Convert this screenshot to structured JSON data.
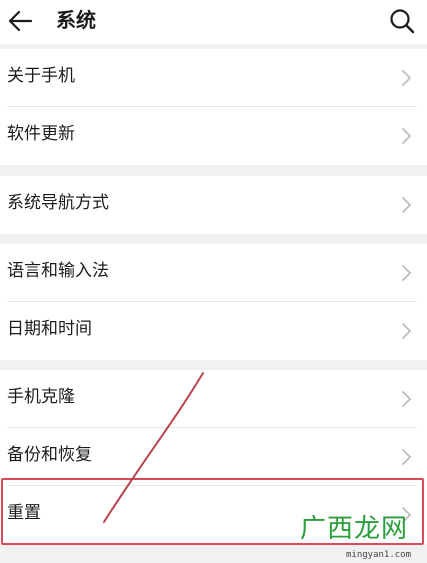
{
  "header": {
    "title": "系统",
    "back_icon": "arrow-left-icon",
    "search_icon": "search-icon"
  },
  "groups": [
    {
      "items": [
        {
          "label": "关于手机"
        },
        {
          "label": "软件更新"
        }
      ]
    },
    {
      "items": [
        {
          "label": "系统导航方式"
        }
      ]
    },
    {
      "items": [
        {
          "label": "语言和输入法"
        },
        {
          "label": "日期和时间"
        }
      ]
    },
    {
      "items": [
        {
          "label": "手机克隆"
        },
        {
          "label": "备份和恢复"
        },
        {
          "label": "重置"
        }
      ]
    }
  ],
  "annotation": {
    "highlighted_item": "重置",
    "highlight_color": "#d94a5a"
  },
  "watermark": {
    "text": "广西龙网",
    "url": "mingyan1.com"
  },
  "colors": {
    "background": "#f1f1f1",
    "surface": "#ffffff",
    "chevron": "#bdbdbd"
  }
}
